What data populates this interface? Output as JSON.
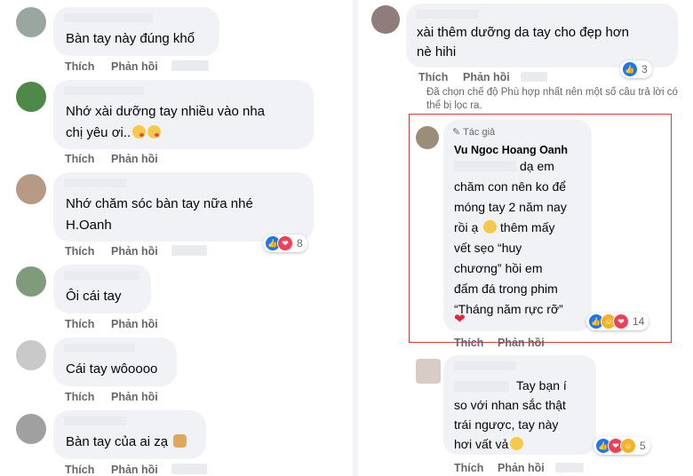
{
  "actions": {
    "like": "Thích",
    "reply": "Phản hồi"
  },
  "left_comments": [
    {
      "lines": [
        "Bàn tay này đúng khổ"
      ]
    },
    {
      "lines": [
        "Nhớ xài dưỡng tay nhiều vào nha",
        "chị yêu ơi.."
      ]
    },
    {
      "lines": [
        "Nhớ chăm sóc bàn tay nữa nhé",
        "H.Oanh"
      ],
      "reaction_count": "8"
    },
    {
      "lines": [
        "Ôi cái tay"
      ]
    },
    {
      "lines": [
        "Cái tay wôoooo"
      ]
    },
    {
      "lines": [
        "Bàn tay của ai zạ"
      ]
    }
  ],
  "right": {
    "top_comment": {
      "lines": [
        "xài thêm dưỡng da tay cho đẹp hơn",
        "nè hihi"
      ],
      "reaction_count": "3"
    },
    "filter_note": "Đã chọn chế độ Phù hợp nhất nên một số câu trả lời có thể bị lọc ra.",
    "author_reply": {
      "tag": "Tác giả",
      "name": "Vu Ngoc Hoang Oanh",
      "lines": [
        "dạ em",
        "chăm con nên ko để",
        "móng tay 2 năm nay",
        "rồi ạ",
        "thêm mấy",
        "vết sẹo “huy",
        "chương” hồi em",
        "đấm đá trong phim",
        "“Tháng năm rực rỡ”"
      ],
      "reaction_count": "14"
    },
    "last_reply": {
      "lines": [
        "Tay bạn í",
        "so với nhan sắc thật",
        "trái ngược, tay này",
        "hơi vất vả"
      ],
      "reaction_count": "5"
    }
  },
  "colors": {
    "bubble": "#f0f2f5",
    "action_text": "#65676b",
    "highlight_border": "#d93a3a",
    "like_blue": "#1877f2",
    "love_red": "#f33e58"
  }
}
